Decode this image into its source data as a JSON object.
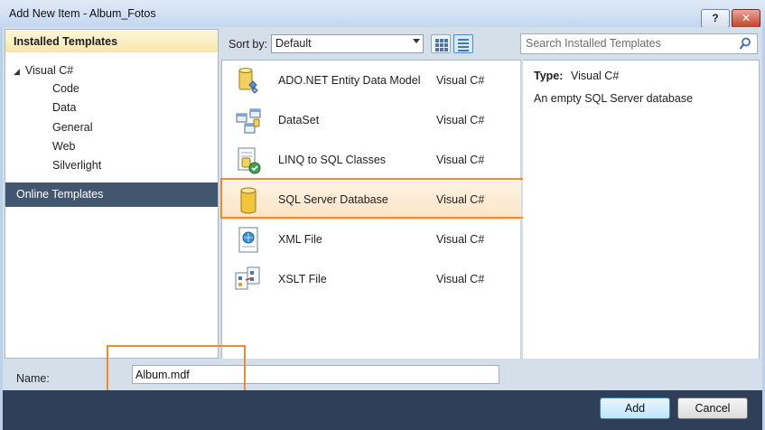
{
  "window": {
    "title": "Add New Item - Album_Fotos",
    "help_label": "?",
    "close_label": "✕"
  },
  "installed": {
    "header": "Installed Templates",
    "root": {
      "label": "Visual C#",
      "expanded": true
    },
    "children": [
      "Code",
      "Data",
      "General",
      "Web",
      "Silverlight"
    ],
    "online": "Online Templates"
  },
  "toolbar": {
    "sort_label": "Sort by:",
    "sort_value": "Default",
    "view_mode_active": "list"
  },
  "search": {
    "placeholder": "Search Installed Templates",
    "value": ""
  },
  "templates": [
    {
      "name": "ADO.NET Entity Data Model",
      "lang": "Visual C#",
      "icon": "entity-model-icon"
    },
    {
      "name": "DataSet",
      "lang": "Visual C#",
      "icon": "dataset-icon"
    },
    {
      "name": "LINQ to SQL Classes",
      "lang": "Visual C#",
      "icon": "linq-to-sql-icon"
    },
    {
      "name": "SQL Server Database",
      "lang": "Visual C#",
      "icon": "database-icon",
      "selected": true
    },
    {
      "name": "XML File",
      "lang": "Visual C#",
      "icon": "xml-file-icon"
    },
    {
      "name": "XSLT File",
      "lang": "Visual C#",
      "icon": "xslt-file-icon"
    }
  ],
  "details": {
    "type_label": "Type:",
    "type_value": "Visual C#",
    "description": "An empty SQL Server database"
  },
  "name_field": {
    "label": "Name:",
    "value": "Album.mdf"
  },
  "buttons": {
    "add": "Add",
    "cancel": "Cancel"
  },
  "colors": {
    "highlight_orange": "#ef8b2c",
    "footer": "#2f3f59",
    "selected_nav": "#43566f"
  }
}
